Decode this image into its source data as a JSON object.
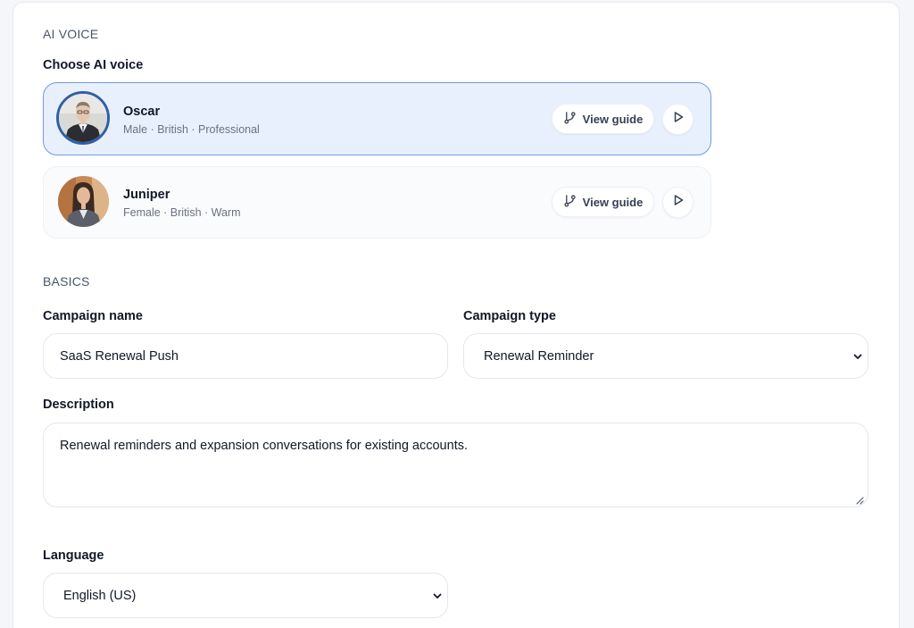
{
  "ai_voice": {
    "section_title": "AI VOICE",
    "choose_label": "Choose AI voice",
    "voices": [
      {
        "name": "Oscar",
        "meta": "Male · British · Professional",
        "guide_label": "View guide",
        "selected": true
      },
      {
        "name": "Juniper",
        "meta": "Female · British · Warm",
        "guide_label": "View guide",
        "selected": false
      }
    ]
  },
  "basics": {
    "section_title": "BASICS",
    "campaign_name": {
      "label": "Campaign name",
      "value": "SaaS Renewal Push"
    },
    "campaign_type": {
      "label": "Campaign type",
      "value": "Renewal Reminder"
    },
    "description": {
      "label": "Description",
      "value": "Renewal reminders and expansion conversations for existing accounts."
    },
    "language": {
      "label": "Language",
      "value": "English (US)"
    }
  },
  "colors": {
    "accent_border": "#6e9be6",
    "selected_bg": "#e9f0fd",
    "avatar_ring": "#2f5fa8"
  }
}
